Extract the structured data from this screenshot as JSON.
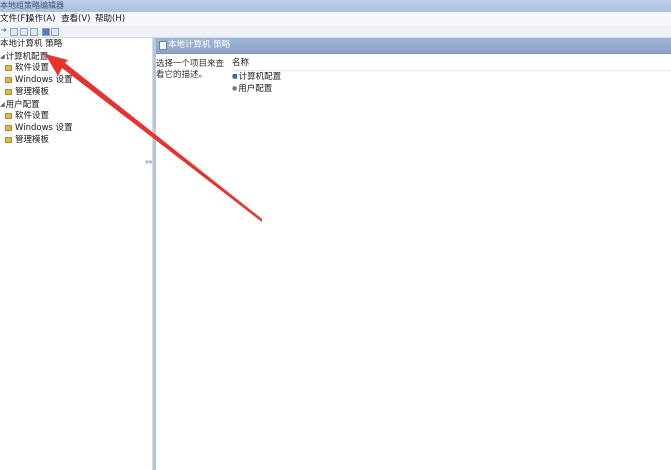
{
  "window": {
    "title": "本地组策略编辑器"
  },
  "menu": [
    {
      "label": "文件(F)"
    },
    {
      "label": "操作(A)"
    },
    {
      "label": "查看(V)"
    },
    {
      "label": "帮助(H)"
    }
  ],
  "tree": {
    "root": "本地计算机 策略",
    "computer_config": {
      "label": "计算机配置",
      "children": [
        "软件设置",
        "Windows 设置",
        "管理模板"
      ]
    },
    "user_config": {
      "label": "用户配置",
      "children": [
        "软件设置",
        "Windows 设置",
        "管理模板"
      ]
    }
  },
  "right_pane": {
    "header_title": "本地计算机 策略",
    "description": "选择一个项目来查看它的描述。",
    "column_name": "名称",
    "items": [
      "计算机配置",
      "用户配置"
    ]
  },
  "colors": {
    "header_blue": "#8aa3c7",
    "annotation_red": "#e8322d"
  }
}
